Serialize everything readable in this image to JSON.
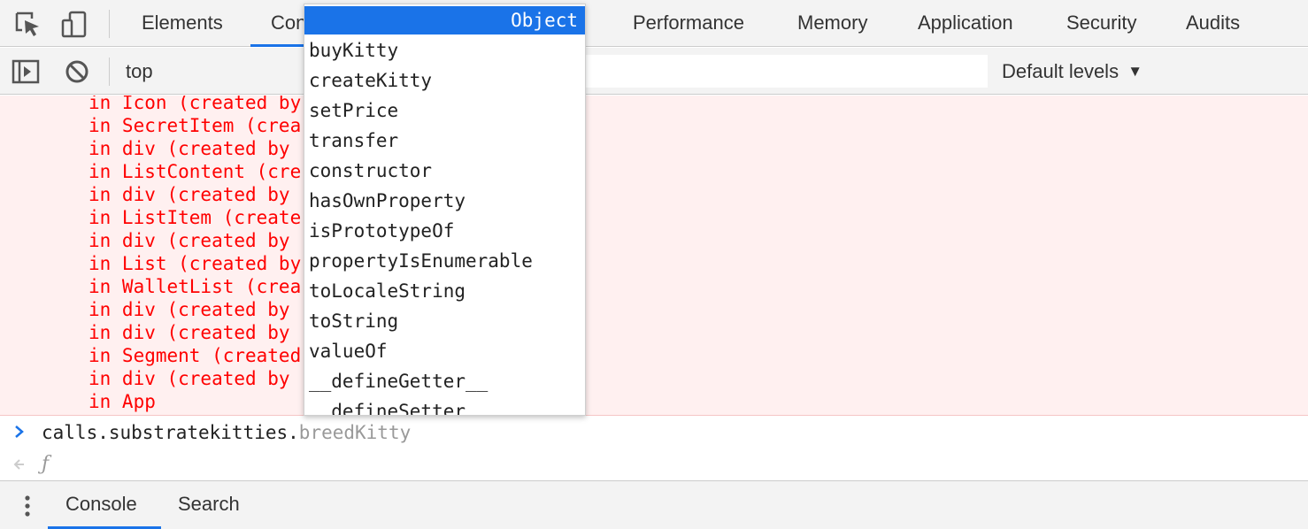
{
  "tabs": {
    "elements": "Elements",
    "console": "Console",
    "performance": "Performance",
    "memory": "Memory",
    "application": "Application",
    "security": "Security",
    "audits": "Audits"
  },
  "toolbar": {
    "context": "top",
    "levels": "Default levels"
  },
  "stack": [
    "in Icon (created by",
    "in SecretItem (crea",
    "in div (created by",
    "in ListContent (cre",
    "in div (created by",
    "in ListItem (create",
    "in div (created by",
    "in List (created by",
    "in WalletList (crea",
    "in div (created by",
    "in div (created by",
    "in Segment (created",
    "in div (created by",
    "in App"
  ],
  "prompt": {
    "typed": "calls.substratekitties.",
    "suggestion": "breedKitty"
  },
  "result": "ƒ",
  "drawer": {
    "console": "Console",
    "search": "Search"
  },
  "autocomplete": {
    "selected": "breedKitty",
    "selected_type": "Object",
    "items": [
      "buyKitty",
      "createKitty",
      "setPrice",
      "transfer",
      "constructor",
      "hasOwnProperty",
      "isPrototypeOf",
      "propertyIsEnumerable",
      "toLocaleString",
      "toString",
      "valueOf",
      "__defineGetter__",
      "__defineSetter__"
    ]
  },
  "colors": {
    "accent": "#1a73e8",
    "error_text": "#ff0000",
    "error_bg": "#fff0f0"
  }
}
